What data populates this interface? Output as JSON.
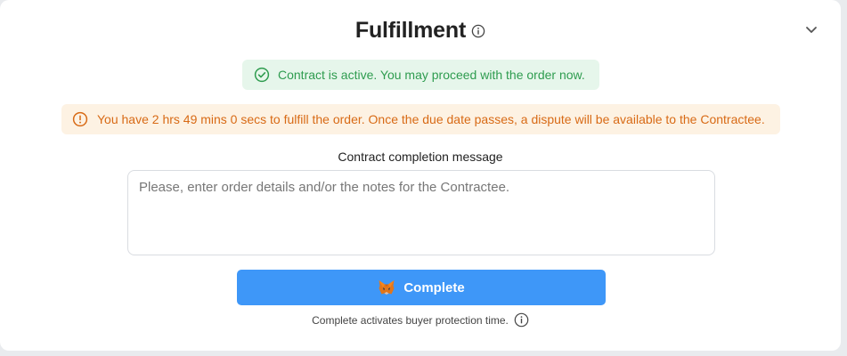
{
  "header": {
    "title": "Fulfillment",
    "info_icon": "info-circle-icon",
    "collapse_icon": "chevron-down-icon"
  },
  "alerts": {
    "success": {
      "icon": "check-circle-icon",
      "text": "Contract is active. You may proceed with the order now."
    },
    "warning": {
      "icon": "exclamation-circle-icon",
      "text": "You have 2 hrs 49 mins 0 secs to fulfill the order. Once the due date passes, a dispute will be available to the Contractee."
    }
  },
  "form": {
    "label": "Contract completion message",
    "placeholder": "Please, enter order details and/or the notes for the Contractee.",
    "value": ""
  },
  "action": {
    "label": "Complete",
    "icon": "metamask-fox-icon"
  },
  "hint": {
    "text": "Complete activates buyer protection time.",
    "icon": "info-circle-icon"
  },
  "colors": {
    "accent": "#3e97f8",
    "success_text": "#2e9c4f",
    "success_bg": "#e6f6eb",
    "warning_text": "#d86a15",
    "warning_bg": "#fdf2e3"
  }
}
